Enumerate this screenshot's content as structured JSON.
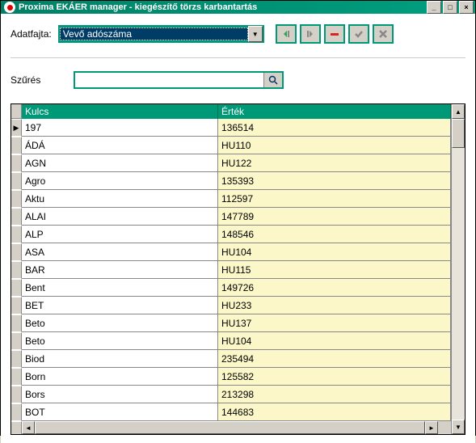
{
  "window": {
    "title": "Proxima EKÁER manager - kiegészítő törzs karbantartás"
  },
  "form": {
    "dataType_label": "Adatfajta:",
    "dataType_value": "Vevő adószáma",
    "filter_label": "Szűrés",
    "search_value": ""
  },
  "grid": {
    "columns": {
      "key": "Kulcs",
      "value": "Érték"
    },
    "rows": [
      {
        "key": "197",
        "value": "136514"
      },
      {
        "key": "ÁDÁ",
        "value": "HU110"
      },
      {
        "key": "AGN",
        "value": "HU122"
      },
      {
        "key": "Agro",
        "value": "135393"
      },
      {
        "key": "Aktu",
        "value": "112597"
      },
      {
        "key": "ALAI",
        "value": "147789"
      },
      {
        "key": "ALP",
        "value": "148546"
      },
      {
        "key": "ASA",
        "value": "HU104"
      },
      {
        "key": "BAR",
        "value": "HU115"
      },
      {
        "key": "Bent",
        "value": "149726"
      },
      {
        "key": "BET",
        "value": "HU233"
      },
      {
        "key": "Beto",
        "value": "HU137"
      },
      {
        "key": "Beto",
        "value": "HU104"
      },
      {
        "key": "Biod",
        "value": "235494"
      },
      {
        "key": "Born",
        "value": "125582"
      },
      {
        "key": "Bors",
        "value": "213298"
      },
      {
        "key": "BOT",
        "value": "144683"
      }
    ]
  }
}
